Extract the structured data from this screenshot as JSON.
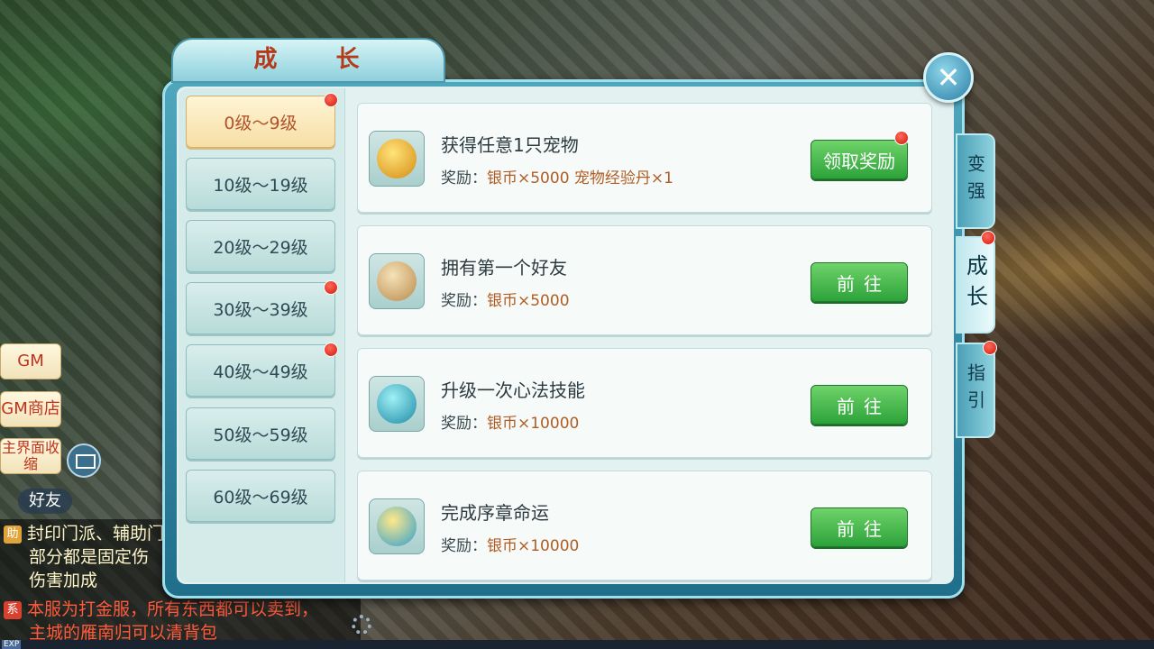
{
  "panel": {
    "title": "成 长"
  },
  "close": {
    "icon": "✕"
  },
  "levels": [
    "0级～9级",
    "10级～19级",
    "20级～29级",
    "30级～39级",
    "40级～49级",
    "50级～59级",
    "60级～69级"
  ],
  "side_tabs": [
    "变强",
    "成长",
    "指引"
  ],
  "reward_prefix": "奖励：",
  "tasks": [
    {
      "title": "获得任意1只宠物",
      "reward": "银币×5000  宠物经验丹×1",
      "button": "领取奖励"
    },
    {
      "title": "拥有第一个好友",
      "reward": "银币×5000",
      "button": "前往"
    },
    {
      "title": "升级一次心法技能",
      "reward": "银币×10000",
      "button": "前往"
    },
    {
      "title": "完成序章命运",
      "reward": "银币×10000",
      "button": "前往"
    }
  ],
  "left_buttons": [
    "GM",
    "GM商店",
    "主界面收缩"
  ],
  "friend_label": "好友",
  "chat": {
    "line1": "封印门派、辅助门",
    "line2": "部分都是固定伤",
    "line3": "伤害加成",
    "line4": "本服为打金服，所有东西都可以卖到，",
    "line5": "主城的雁南归可以清背包",
    "tag_assist": "助",
    "tag_system": "系"
  },
  "exp_label": "EXP",
  "colors": {
    "accent_red": "#c2321d",
    "button_green": "#2da23a",
    "reward_orange": "#b15c22",
    "panel_teal": "#1f6e8a"
  }
}
